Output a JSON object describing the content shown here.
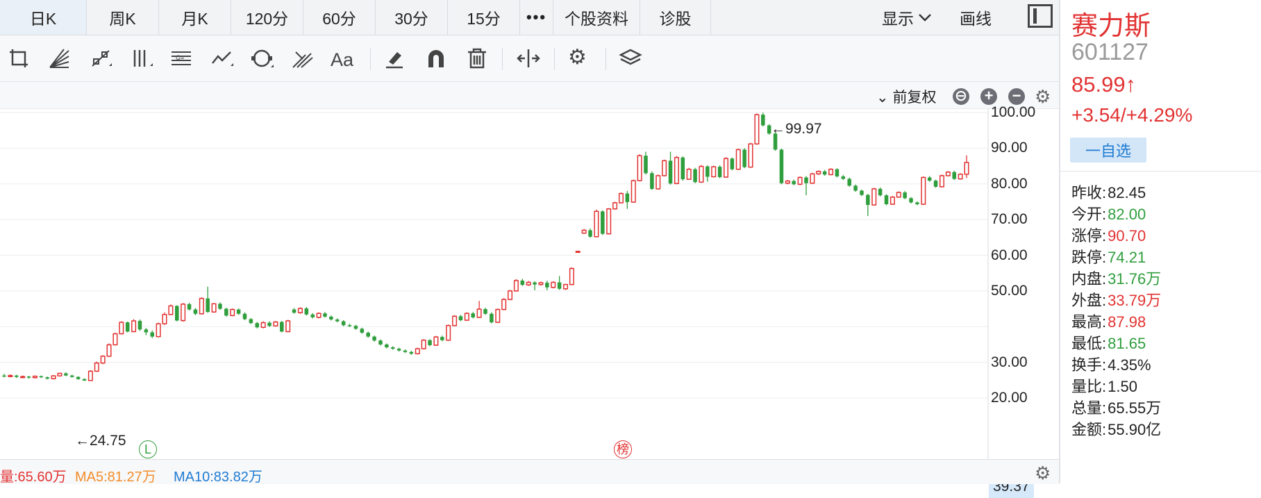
{
  "tabs": [
    "日K",
    "周K",
    "月K",
    "120分",
    "60分",
    "30分",
    "15分",
    "•••",
    "个股资料",
    "诊股"
  ],
  "tabs_right": {
    "display_label": "显示",
    "draw_label": "画线"
  },
  "toolbar_icons": [
    "crop-icon",
    "fan-lines-icon",
    "segment-icon",
    "vertical-lines-icon",
    "text-lines-icon",
    "polyline-icon",
    "cycle-icon",
    "pitchfork-icon",
    "text-icon",
    "eraser-icon",
    "magnet-icon",
    "trash-icon",
    "measure-icon",
    "gear-icon",
    "layers-icon"
  ],
  "toolbar": {
    "text_tool_label": "Aa"
  },
  "adjust": {
    "label": "前复权"
  },
  "chart_data": {
    "type": "candlestick",
    "yaxis_ticks": [
      "100.00",
      "90.00",
      "80.00",
      "70.00",
      "60.00",
      "50.00",
      "30.00",
      "20.00"
    ],
    "ylim": [
      20,
      100
    ],
    "current_label": "39.37",
    "high_note": "←99.97",
    "low_note": "←24.75",
    "markers": {
      "l": "L",
      "bang": "榜"
    },
    "candles": [
      [
        26.3,
        26.0,
        26.8,
        25.8
      ],
      [
        26.0,
        26.3,
        26.6,
        25.8
      ],
      [
        26.3,
        25.9,
        26.5,
        25.6
      ],
      [
        25.9,
        26.0,
        26.3,
        25.6
      ],
      [
        26.0,
        25.7,
        26.2,
        25.4
      ],
      [
        25.7,
        26.1,
        26.3,
        25.5
      ],
      [
        26.1,
        25.8,
        26.3,
        25.6
      ],
      [
        25.8,
        25.4,
        26.0,
        25.2
      ],
      [
        25.4,
        26.2,
        26.4,
        25.2
      ],
      [
        26.2,
        26.9,
        27.1,
        26.0
      ],
      [
        26.9,
        26.3,
        27.2,
        26.1
      ],
      [
        26.3,
        25.9,
        26.5,
        25.7
      ],
      [
        25.9,
        25.3,
        26.1,
        25.1
      ],
      [
        25.3,
        24.9,
        25.5,
        24.75
      ],
      [
        24.9,
        27.5,
        27.8,
        24.8
      ],
      [
        27.5,
        29.8,
        30.2,
        27.3
      ],
      [
        29.8,
        31.7,
        32.0,
        29.5
      ],
      [
        31.7,
        34.9,
        35.3,
        31.5
      ],
      [
        34.9,
        38.0,
        38.3,
        34.7
      ],
      [
        38.0,
        41.2,
        41.5,
        37.8
      ],
      [
        41.2,
        38.6,
        41.4,
        38.4
      ],
      [
        38.6,
        41.6,
        42.1,
        38.4
      ],
      [
        41.6,
        39.2,
        42.0,
        38.8
      ],
      [
        39.2,
        38.4,
        39.6,
        37.6
      ],
      [
        38.4,
        37.2,
        38.9,
        36.8
      ],
      [
        37.2,
        40.8,
        41.1,
        37.0
      ],
      [
        40.8,
        43.4,
        44.0,
        40.5
      ],
      [
        43.4,
        45.8,
        46.2,
        43.2
      ],
      [
        45.8,
        41.7,
        46.0,
        41.5
      ],
      [
        41.7,
        46.3,
        46.6,
        41.4
      ],
      [
        46.3,
        44.8,
        46.7,
        44.5
      ],
      [
        44.8,
        43.6,
        45.2,
        43.2
      ],
      [
        43.6,
        47.9,
        48.2,
        43.4
      ],
      [
        47.9,
        44.1,
        51.2,
        43.9
      ],
      [
        44.1,
        46.4,
        46.6,
        43.9
      ],
      [
        46.4,
        45.0,
        46.8,
        44.7
      ],
      [
        45.0,
        43.1,
        45.3,
        42.8
      ],
      [
        43.1,
        44.8,
        45.1,
        42.9
      ],
      [
        44.8,
        43.6,
        45.1,
        43.3
      ],
      [
        43.6,
        42.1,
        44.0,
        41.8
      ],
      [
        42.1,
        41.0,
        42.4,
        40.7
      ],
      [
        41.0,
        39.8,
        41.3,
        39.5
      ],
      [
        39.8,
        41.1,
        41.5,
        39.5
      ],
      [
        41.1,
        40.2,
        41.5,
        39.9
      ],
      [
        40.2,
        41.3,
        41.6,
        40.0
      ],
      [
        41.3,
        38.6,
        41.6,
        38.4
      ],
      [
        38.6,
        41.6,
        41.9,
        38.4
      ],
      [
        44.8,
        43.9,
        45.2,
        43.6
      ],
      [
        43.9,
        45.1,
        45.4,
        43.6
      ],
      [
        45.1,
        43.4,
        45.5,
        43.1
      ],
      [
        43.4,
        42.6,
        43.8,
        42.3
      ],
      [
        42.6,
        43.7,
        44.0,
        42.3
      ],
      [
        43.7,
        42.8,
        44.1,
        42.5
      ],
      [
        42.8,
        42.0,
        43.1,
        41.7
      ],
      [
        42.0,
        41.5,
        42.3,
        41.2
      ],
      [
        41.5,
        40.4,
        41.8,
        40.1
      ],
      [
        40.4,
        40.2,
        40.8,
        39.9
      ],
      [
        40.2,
        39.4,
        40.5,
        39.1
      ],
      [
        39.4,
        38.3,
        39.7,
        38.0
      ],
      [
        38.3,
        37.2,
        38.6,
        36.9
      ],
      [
        37.2,
        36.1,
        37.5,
        35.8
      ],
      [
        36.1,
        35.0,
        36.4,
        34.7
      ],
      [
        35.0,
        34.2,
        35.3,
        33.9
      ],
      [
        34.2,
        33.8,
        34.5,
        33.5
      ],
      [
        33.8,
        33.3,
        34.1,
        33.0
      ],
      [
        33.3,
        32.9,
        33.6,
        32.6
      ],
      [
        32.9,
        32.4,
        33.2,
        32.1
      ],
      [
        32.4,
        33.8,
        34.1,
        32.2
      ],
      [
        33.8,
        36.2,
        36.5,
        33.6
      ],
      [
        36.2,
        34.8,
        36.5,
        34.5
      ],
      [
        34.8,
        37.1,
        37.4,
        34.6
      ],
      [
        37.1,
        36.2,
        37.5,
        35.9
      ],
      [
        36.2,
        40.3,
        40.6,
        36.0
      ],
      [
        40.3,
        42.9,
        43.2,
        40.1
      ],
      [
        42.9,
        41.8,
        43.3,
        41.5
      ],
      [
        41.8,
        43.7,
        44.0,
        41.6
      ],
      [
        43.7,
        42.6,
        44.1,
        42.3
      ],
      [
        42.6,
        44.9,
        47.2,
        42.4
      ],
      [
        44.9,
        43.6,
        45.3,
        43.3
      ],
      [
        43.6,
        41.2,
        44.0,
        40.9
      ],
      [
        41.2,
        44.8,
        45.1,
        41.0
      ],
      [
        44.8,
        47.6,
        48.0,
        44.6
      ],
      [
        47.6,
        50.0,
        50.3,
        47.4
      ],
      [
        50.0,
        52.9,
        53.3,
        49.8
      ],
      [
        52.9,
        51.7,
        53.4,
        51.4
      ],
      [
        51.7,
        52.4,
        52.8,
        51.4
      ],
      [
        52.4,
        51.8,
        52.7,
        50.2
      ],
      [
        51.8,
        52.3,
        52.6,
        51.5
      ],
      [
        52.3,
        51.0,
        52.9,
        50.2
      ],
      [
        51.0,
        52.4,
        52.7,
        50.7
      ],
      [
        52.4,
        50.6,
        54.2,
        50.3
      ],
      [
        50.6,
        51.8,
        52.0,
        50.3
      ],
      [
        51.8,
        56.3,
        56.6,
        51.6
      ],
      [
        61.0,
        61.1,
        61.3,
        60.8
      ],
      [
        66.2,
        67.0,
        67.4,
        66.0
      ],
      [
        67.0,
        65.2,
        67.5,
        64.9
      ],
      [
        65.2,
        72.3,
        72.8,
        65.0
      ],
      [
        72.3,
        66.0,
        72.6,
        65.7
      ],
      [
        66.0,
        73.0,
        73.2,
        65.8
      ],
      [
        73.0,
        74.7,
        75.0,
        72.8
      ],
      [
        74.7,
        77.3,
        77.6,
        74.5
      ],
      [
        77.3,
        74.9,
        78.0,
        73.0
      ],
      [
        74.9,
        80.9,
        81.2,
        74.7
      ],
      [
        80.9,
        87.9,
        88.3,
        80.7
      ],
      [
        87.9,
        83.0,
        89.0,
        82.6
      ],
      [
        83.0,
        78.6,
        83.5,
        78.3
      ],
      [
        78.6,
        82.3,
        82.6,
        78.4
      ],
      [
        82.3,
        86.5,
        86.8,
        82.1
      ],
      [
        86.5,
        80.1,
        89.0,
        79.8
      ],
      [
        80.1,
        87.4,
        87.8,
        79.9
      ],
      [
        87.4,
        81.3,
        87.7,
        80.9
      ],
      [
        81.3,
        84.1,
        84.5,
        81.1
      ],
      [
        84.1,
        80.5,
        84.5,
        80.2
      ],
      [
        80.5,
        84.9,
        85.3,
        80.3
      ],
      [
        84.9,
        82.0,
        85.2,
        80.6
      ],
      [
        82.0,
        84.8,
        85.1,
        81.8
      ],
      [
        84.8,
        81.9,
        85.2,
        81.6
      ],
      [
        81.9,
        87.1,
        87.5,
        81.7
      ],
      [
        87.1,
        84.1,
        87.4,
        83.8
      ],
      [
        84.1,
        89.6,
        89.9,
        83.9
      ],
      [
        89.6,
        84.7,
        90.0,
        84.4
      ],
      [
        84.7,
        91.2,
        91.5,
        84.5
      ],
      [
        91.2,
        99.4,
        99.7,
        91.0
      ],
      [
        99.4,
        96.4,
        99.97,
        96.1
      ],
      [
        96.4,
        94.1,
        96.7,
        93.8
      ],
      [
        94.1,
        89.6,
        94.4,
        89.3
      ],
      [
        89.6,
        80.2,
        89.9,
        79.9
      ],
      [
        80.2,
        80.8,
        81.1,
        79.9
      ],
      [
        80.8,
        79.9,
        81.2,
        79.6
      ],
      [
        79.9,
        81.8,
        82.1,
        79.6
      ],
      [
        81.8,
        80.2,
        82.2,
        76.8
      ],
      [
        80.2,
        82.8,
        83.1,
        80.0
      ],
      [
        82.8,
        83.5,
        83.8,
        82.5
      ],
      [
        83.5,
        82.6,
        83.9,
        82.3
      ],
      [
        82.6,
        84.1,
        84.4,
        82.4
      ],
      [
        84.1,
        82.1,
        84.4,
        81.8
      ],
      [
        82.1,
        81.4,
        82.5,
        81.1
      ],
      [
        81.4,
        79.5,
        81.8,
        79.2
      ],
      [
        79.5,
        78.1,
        79.8,
        77.8
      ],
      [
        78.1,
        76.9,
        78.4,
        76.6
      ],
      [
        76.9,
        74.1,
        77.2,
        71.0
      ],
      [
        74.1,
        78.6,
        78.9,
        73.9
      ],
      [
        78.6,
        76.8,
        79.0,
        76.5
      ],
      [
        76.8,
        74.3,
        77.1,
        74.0
      ],
      [
        74.3,
        76.3,
        76.6,
        74.1
      ],
      [
        76.3,
        77.6,
        77.9,
        76.1
      ],
      [
        77.6,
        76.0,
        78.0,
        75.7
      ],
      [
        76.0,
        74.8,
        76.3,
        74.5
      ],
      [
        74.8,
        74.3,
        75.1,
        74.0
      ],
      [
        74.3,
        81.8,
        82.1,
        74.1
      ],
      [
        81.8,
        80.9,
        82.2,
        80.6
      ],
      [
        80.9,
        79.2,
        81.2,
        78.9
      ],
      [
        79.2,
        82.3,
        82.6,
        79.0
      ],
      [
        82.3,
        83.3,
        83.6,
        82.1
      ],
      [
        83.3,
        81.4,
        83.7,
        81.1
      ],
      [
        81.4,
        82.7,
        83.0,
        81.2
      ],
      [
        82.7,
        86.0,
        87.98,
        81.65
      ]
    ]
  },
  "ma_strip": {
    "vol": "量:65.60万",
    "ma5": "MA5:81.27万",
    "ma10": "MA10:83.82万"
  },
  "stock": {
    "name": "赛力斯",
    "code": "601127",
    "price": "85.99↑",
    "change": "+3.54/+4.29%",
    "fav_label": "一自选"
  },
  "quote_rows": [
    {
      "label": "昨收:",
      "value": "82.45",
      "color": "black"
    },
    {
      "label": "今开:",
      "value": "82.00",
      "color": "green"
    },
    {
      "label": "涨停:",
      "value": "90.70",
      "color": "red"
    },
    {
      "label": "跌停:",
      "value": "74.21",
      "color": "green"
    },
    {
      "label": "内盘:",
      "value": "31.76万",
      "color": "green"
    },
    {
      "label": "外盘:",
      "value": "33.79万",
      "color": "red"
    },
    {
      "label": "最高:",
      "value": "87.98",
      "color": "red"
    },
    {
      "label": "最低:",
      "value": "81.65",
      "color": "green"
    },
    {
      "label": "换手:",
      "value": "4.35%",
      "color": "black"
    },
    {
      "label": "量比:",
      "value": "1.50",
      "color": "black"
    },
    {
      "label": "总量:",
      "value": "65.55万",
      "color": "black"
    },
    {
      "label": "金额:",
      "value": "55.90亿",
      "color": "black"
    }
  ],
  "colors": {
    "up": "#e23232",
    "down": "#2f9e3d",
    "accent": "#1f7bd1"
  }
}
